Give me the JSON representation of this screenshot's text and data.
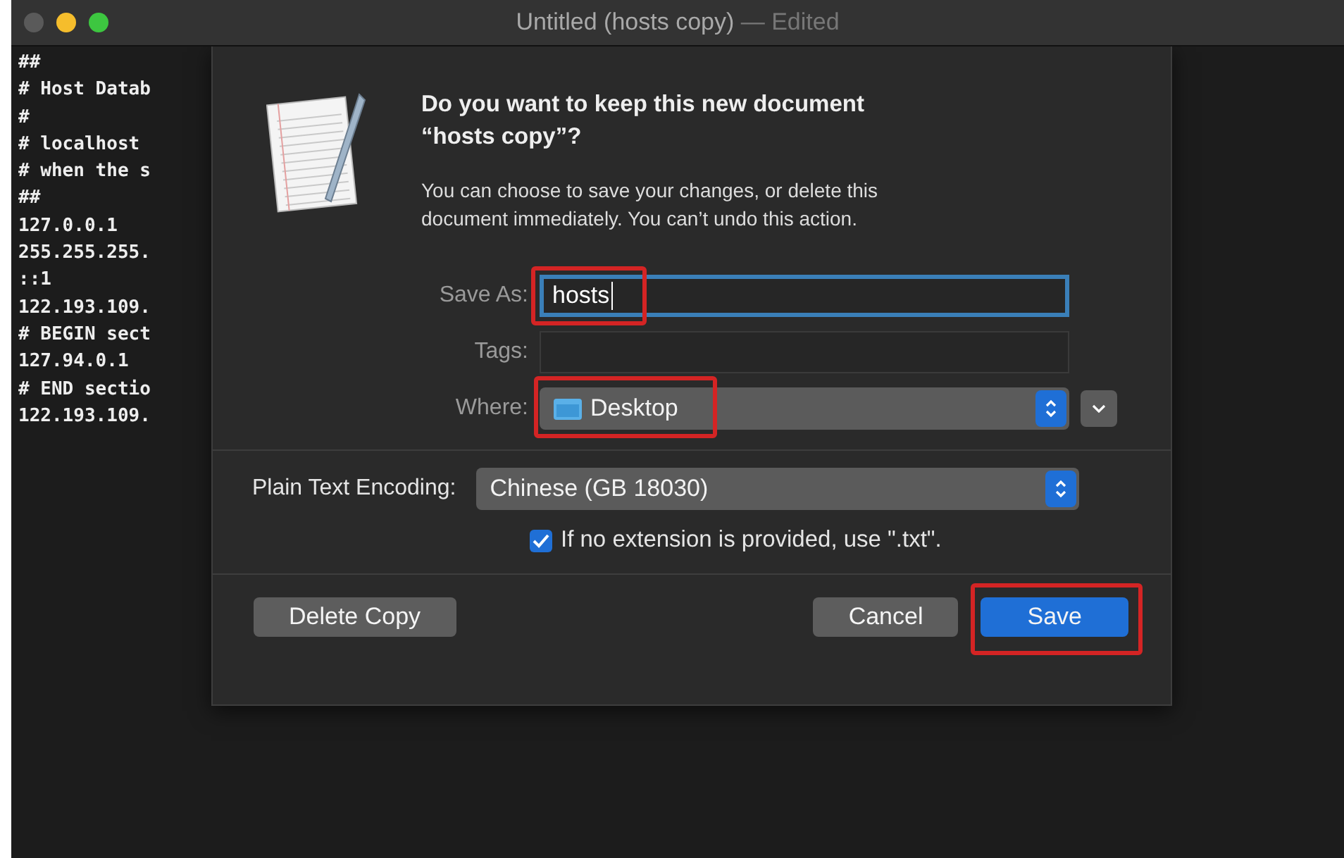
{
  "window": {
    "title": "Untitled (hosts copy)",
    "title_suffix": "— Edited"
  },
  "editor": {
    "lines": [
      "##",
      "# Host Datab",
      "#",
      "# localhost",
      "# when the s",
      "##",
      "127.0.0.1",
      "255.255.255.",
      "::1",
      "122.193.109.",
      "# BEGIN sect",
      "127.94.0.1",
      "# END sectio",
      "122.193.109."
    ]
  },
  "dialog": {
    "heading": "Do you want to keep this new document “hosts copy”?",
    "message": "You can choose to save your changes, or delete this document immediately. You can’t undo this action.",
    "save_as": {
      "label": "Save As:",
      "value": "hosts",
      "highlighted": true
    },
    "tags": {
      "label": "Tags:"
    },
    "where": {
      "label": "Where:",
      "value": "Desktop",
      "highlighted": true
    },
    "encoding": {
      "label": "Plain Text Encoding:",
      "value": "Chinese (GB 18030)"
    },
    "extension_option": {
      "label": "If no extension is provided, use \".txt\".",
      "checked": true
    },
    "buttons": [
      {
        "label": "Delete Copy",
        "kind": "secondary",
        "highlighted": false
      },
      {
        "label": "Cancel",
        "kind": "secondary",
        "highlighted": false
      },
      {
        "label": "Save",
        "kind": "primary",
        "highlighted": true
      }
    ]
  }
}
